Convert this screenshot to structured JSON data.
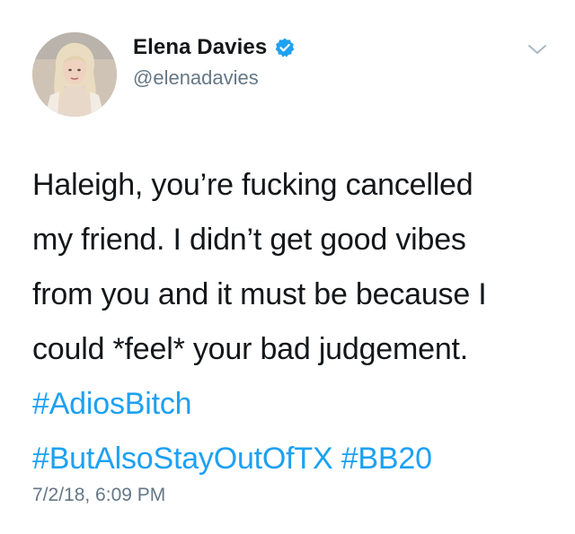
{
  "colors": {
    "text": "#14171a",
    "secondary": "#657786",
    "link": "#1da1f2",
    "verified": "#1da1f2"
  },
  "author": {
    "display_name": "Elena Davies",
    "handle": "@elenadavies",
    "verified": true,
    "avatar_icon": "profile-photo",
    "verified_icon": "verified-badge-icon",
    "menu_icon": "chevron-down-icon"
  },
  "tweet": {
    "lines": [
      "Haleigh, you’re fucking cancelled",
      "my friend. I didn’t get good vibes",
      "from you and it must be because I",
      "could *feel* your bad judgement."
    ],
    "hashtags": [
      "#AdiosBitch",
      "#ButAlsoStayOutOfTX",
      "#BB20"
    ],
    "timestamp": "7/2/18, 6:09 PM"
  }
}
